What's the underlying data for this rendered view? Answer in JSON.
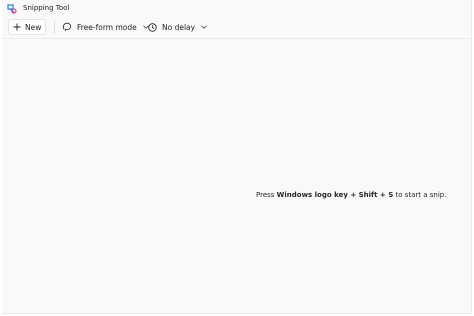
{
  "window": {
    "title": "Snipping Tool"
  },
  "toolbar": {
    "new_label": "New",
    "mode_label": "Free-form mode",
    "delay_label": "No delay"
  },
  "icons": {
    "app": "snipping-tool-icon",
    "new": "plus-icon",
    "mode": "free-form-icon",
    "delay": "clock-icon",
    "dropdown": "chevron-down-icon"
  },
  "hint": {
    "prefix": "Press ",
    "shortcut": "Windows logo key + Shift + S",
    "suffix": " to start a snip."
  },
  "colors": {
    "accent": "#0067c0",
    "background": "#f9f9f9"
  }
}
